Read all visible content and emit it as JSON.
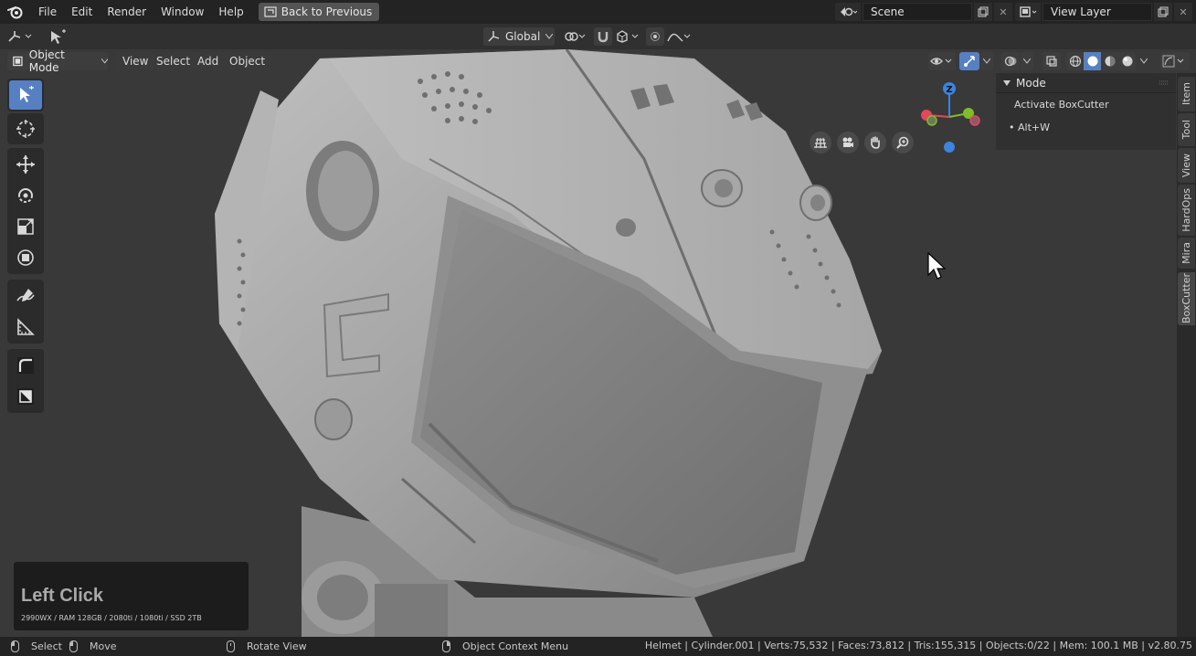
{
  "topbar": {
    "menus": [
      "File",
      "Edit",
      "Render",
      "Window",
      "Help"
    ],
    "back_button": "Back to Previous",
    "scene_name": "Scene",
    "view_layer_name": "View Layer"
  },
  "toolrow": {
    "orientation": "Global"
  },
  "viewport_header": {
    "mode": "Object Mode",
    "menus": [
      "View",
      "Select",
      "Add",
      "Object"
    ]
  },
  "gizmo": {
    "z_label": "Z"
  },
  "sidebar": {
    "panel_title": "Mode",
    "activate_label": "Activate BoxCutter",
    "shortcut": "• Alt+W",
    "tabs": [
      "Item",
      "Tool",
      "View",
      "HardOps",
      "Mira",
      "BoxCutter"
    ],
    "active_tab": "BoxCutter"
  },
  "screencast": {
    "key": "Left Click",
    "specs": "2990WX / RAM 128GB / 2080ti / 1080ti / SSD 2TB"
  },
  "statusbar": {
    "select": "Select",
    "move": "Move",
    "rotate_view": "Rotate View",
    "context_menu": "Object Context Menu",
    "stats": "Helmet | Cylinder.001 | Verts:75,532 | Faces:73,812 | Tris:155,315 | Objects:0/22 | Mem: 100.1 MB | v2.80.75"
  },
  "colors": {
    "accent_blue": "#5680c2",
    "axis_x": "#e5475a",
    "axis_y": "#7fbc2a",
    "axis_z": "#3b84e0"
  }
}
